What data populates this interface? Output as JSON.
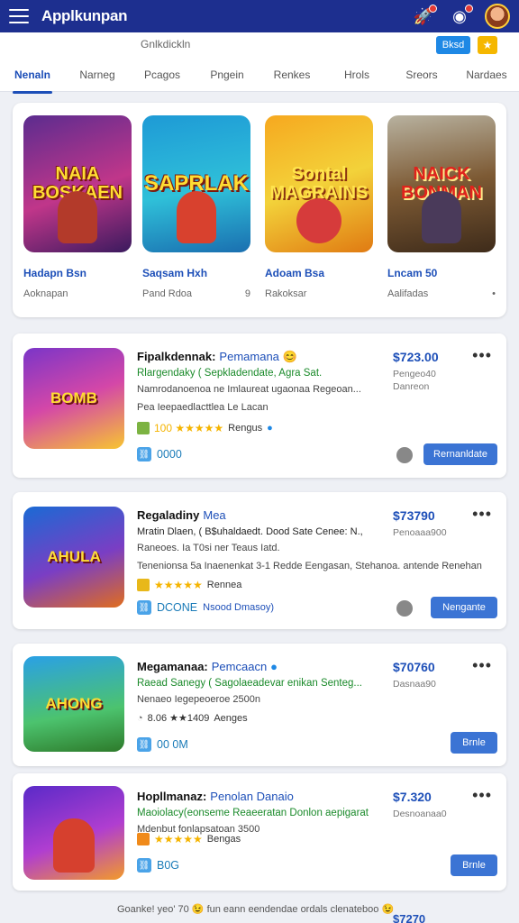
{
  "app": {
    "title": "Applkunpan",
    "colors": {
      "brand": "#1d2f8f",
      "accent": "#1d4fb8",
      "price": "#1d4fb8",
      "green": "#1a8a2a"
    },
    "icons": [
      "menu-icon",
      "rocket-icon",
      "notification-icon",
      "avatar"
    ]
  },
  "subheader": {
    "text": "Gnlkdickln",
    "chip_blue": "Bksd",
    "chip_yellow": "★"
  },
  "tabs": [
    "Nenaln",
    "Narneg",
    "Pcagos",
    "Pngein",
    "Renkes",
    "Hrols",
    "Sreors",
    "Nardaes"
  ],
  "featured": [
    {
      "art": "NAIA BOSKAEN",
      "title": "Hadapn Bsn",
      "sub": "Aoknapan",
      "meta": ""
    },
    {
      "art": "SAPRLAK",
      "title": "Saqsam Hxh",
      "sub": "Pand Rdoa",
      "meta": "9"
    },
    {
      "art": "Sontal MAGRAINS",
      "title": "Adoam Bsa",
      "sub": "Rakoksar",
      "meta": ""
    },
    {
      "art": "NAICK BONMAN",
      "title": "Lncam 50",
      "sub": "Aalifadas",
      "meta": "•"
    }
  ],
  "items": [
    {
      "art": "BOMB",
      "title": "Fipalkdennak:",
      "tag": "Pemamana 😊",
      "green": "Rlargendaky ( Sepkladendate, Agra Sat.",
      "desc": "Namrodanoenoa ne Imlaureat ugaonaa Regeoan...",
      "desc2": "Pea Ieepaedlacttlea Le Lacan",
      "rating": "100 ★★★★★",
      "rating_label": "Rengus",
      "badge": "0000",
      "price": "$723.00",
      "price_sub1": "Pengeo40",
      "price_sub2": "Danreon",
      "action": "Rernanldate"
    },
    {
      "art": "AHULA",
      "title": "Regaladiny",
      "tag": "Mea",
      "green": "Mratin Dlaen, ( B$uhaldaedt. Dood Sate Cenee: N.,",
      "desc": "Raneoes. Ia T0si ner Teaus Iatd.",
      "desc2": "Tenenionsa 5a Inaenenkat 3-1 Redde Eengasan, Stehanoa. antende Renehan",
      "rating": "★★★★★",
      "rating_label": "Rennea",
      "badge": "DCONE",
      "badge2": "Nsood Dmasoy)",
      "price": "$73790",
      "price_sub1": "Penoaaa900",
      "price_sub2": "",
      "action": "Nengante"
    },
    {
      "art": "AHONG",
      "title": "Megamanaa:",
      "tag": "Pemcaacn",
      "green": "Raead Sanegy ( Sagolaeadevar enikan Senteg...",
      "desc": "Nenaeo Iegepeoeroe 2500n",
      "desc2": "",
      "rating": "8.06 ★★1409",
      "rating_label": "Aenges",
      "badge": "00 0M",
      "price": "$70760",
      "price_sub1": "Dasnaa90",
      "price_sub2": "",
      "action": "Brnle"
    },
    {
      "art": "",
      "title": "Hopllmanaz:",
      "tag": "Penolan Danaio",
      "green": "Maoiolacy(eonseme Reaeeratan Donlon aepigarat",
      "desc": "Mdenbut fonlapsatoan 3500",
      "desc2": "",
      "rating": "★★★★★",
      "rating_label": "Bengas",
      "badge": "B0G",
      "price": "$7.320",
      "price_sub1": "Desnoanaa0",
      "price_sub2": "",
      "action": "Brnle"
    }
  ],
  "footer": {
    "text": "Goanke! yeo' 70 😉 fun eann eendendae ordals clenateboo 😉",
    "price": "$7270"
  }
}
